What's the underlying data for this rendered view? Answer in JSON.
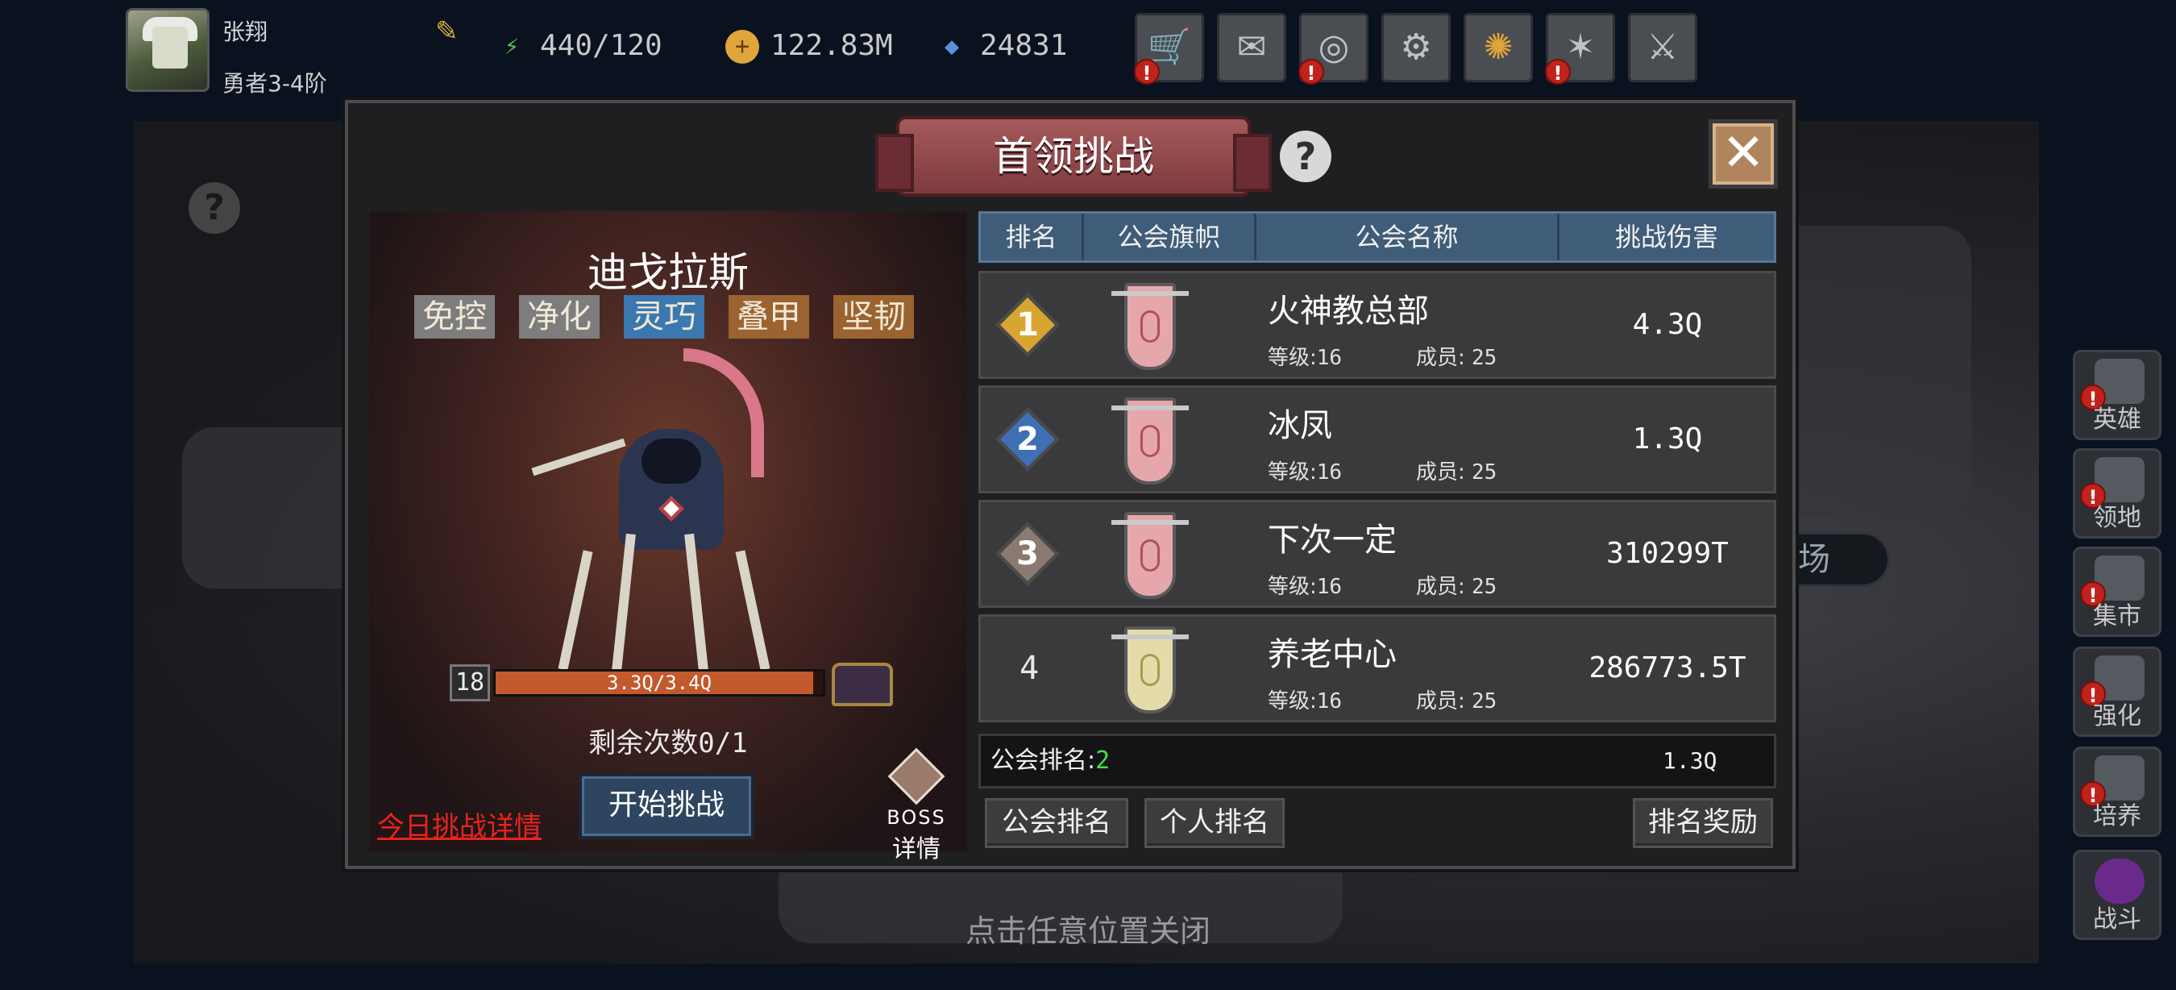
{
  "player": {
    "name": "张翔",
    "rank": "勇者3-4阶"
  },
  "resources": [
    {
      "icon": "energy-icon",
      "value": "440/120",
      "color": "#5cc24e"
    },
    {
      "icon": "gold-coin-icon",
      "value": "122.83M",
      "color": "#e0a53a"
    },
    {
      "icon": "diamond-icon",
      "value": "24831",
      "color": "#5b8fd6"
    }
  ],
  "toolbar": [
    {
      "name": "shop-button",
      "icon": "cart-icon",
      "alert": true
    },
    {
      "name": "mail-button",
      "icon": "envelope-icon",
      "alert": false
    },
    {
      "name": "gamepad-button",
      "icon": "gamepad-icon",
      "alert": true
    },
    {
      "name": "settings-button",
      "icon": "gear-icon",
      "alert": false
    },
    {
      "name": "wheel-button",
      "icon": "color-wheel-icon",
      "alert": false
    },
    {
      "name": "fireworks-button",
      "icon": "fireworks-icon",
      "alert": true
    },
    {
      "name": "swords-button",
      "icon": "crossed-swords-icon",
      "alert": false
    }
  ],
  "side_menu": [
    {
      "label": "英雄",
      "icon": "hero-helmet-icon",
      "alert": true
    },
    {
      "label": "领地",
      "icon": "territory-gate-icon",
      "alert": true
    },
    {
      "label": "集市",
      "icon": "market-stall-icon",
      "alert": true
    },
    {
      "label": "强化",
      "icon": "enhance-crystal-icon",
      "alert": true
    },
    {
      "label": "培养",
      "icon": "nurture-chalice-icon",
      "alert": true
    },
    {
      "label": "战斗",
      "icon": "battle-portal-icon",
      "alert": false
    }
  ],
  "world": {
    "banner_text": "场"
  },
  "modal": {
    "title": "首领挑战",
    "help_symbol": "?",
    "close_symbol": "✕",
    "boss": {
      "name": "迪戈拉斯",
      "tags": [
        {
          "label": "免控",
          "color": "#7d7d7d"
        },
        {
          "label": "净化",
          "color": "#7d7d7d"
        },
        {
          "label": "灵巧",
          "color": "#3b78b0"
        },
        {
          "label": "叠甲",
          "color": "#9a6330"
        },
        {
          "label": "坚韧",
          "color": "#9a6330"
        }
      ],
      "level": "18",
      "hp_text": "3.3Q/3.4Q",
      "hp_fraction": 0.97,
      "remaining_label": "剩余次数",
      "remaining_value": "0/1",
      "today_link": "今日挑战详情",
      "start_button": "开始挑战",
      "detail_line1": "BOSS",
      "detail_line2": "详情"
    },
    "table": {
      "headers": [
        "排名",
        "公会旗帜",
        "公会名称",
        "挑战伤害"
      ],
      "level_label": "等级:",
      "member_label": "成员:",
      "rows": [
        {
          "rank": "1",
          "badge_color": "#d9a531",
          "flag_color": "#e5a7ab",
          "name": "火神教总部",
          "level": "16",
          "members": "25",
          "damage": "4.3Q"
        },
        {
          "rank": "2",
          "badge_color": "#3f6fb5",
          "flag_color": "#e5a7ab",
          "name": "冰凤",
          "level": "16",
          "members": "25",
          "damage": "1.3Q"
        },
        {
          "rank": "3",
          "badge_color": "#8a7a72",
          "flag_color": "#e5a7ab",
          "name": "下次一定",
          "level": "16",
          "members": "25",
          "damage": "310299T"
        },
        {
          "rank": "4",
          "badge_color": "",
          "flag_color": "#e3dcaa",
          "name": "养老中心",
          "level": "16",
          "members": "25",
          "damage": "286773.5T"
        }
      ],
      "my_rank_label": "公会排名:",
      "my_rank_value": "2",
      "my_damage": "1.3Q"
    },
    "buttons": {
      "guild_rank": "公会排名",
      "personal_rank": "个人排名",
      "rank_reward": "排名奖励"
    }
  },
  "close_hint": "点击任意位置关闭"
}
